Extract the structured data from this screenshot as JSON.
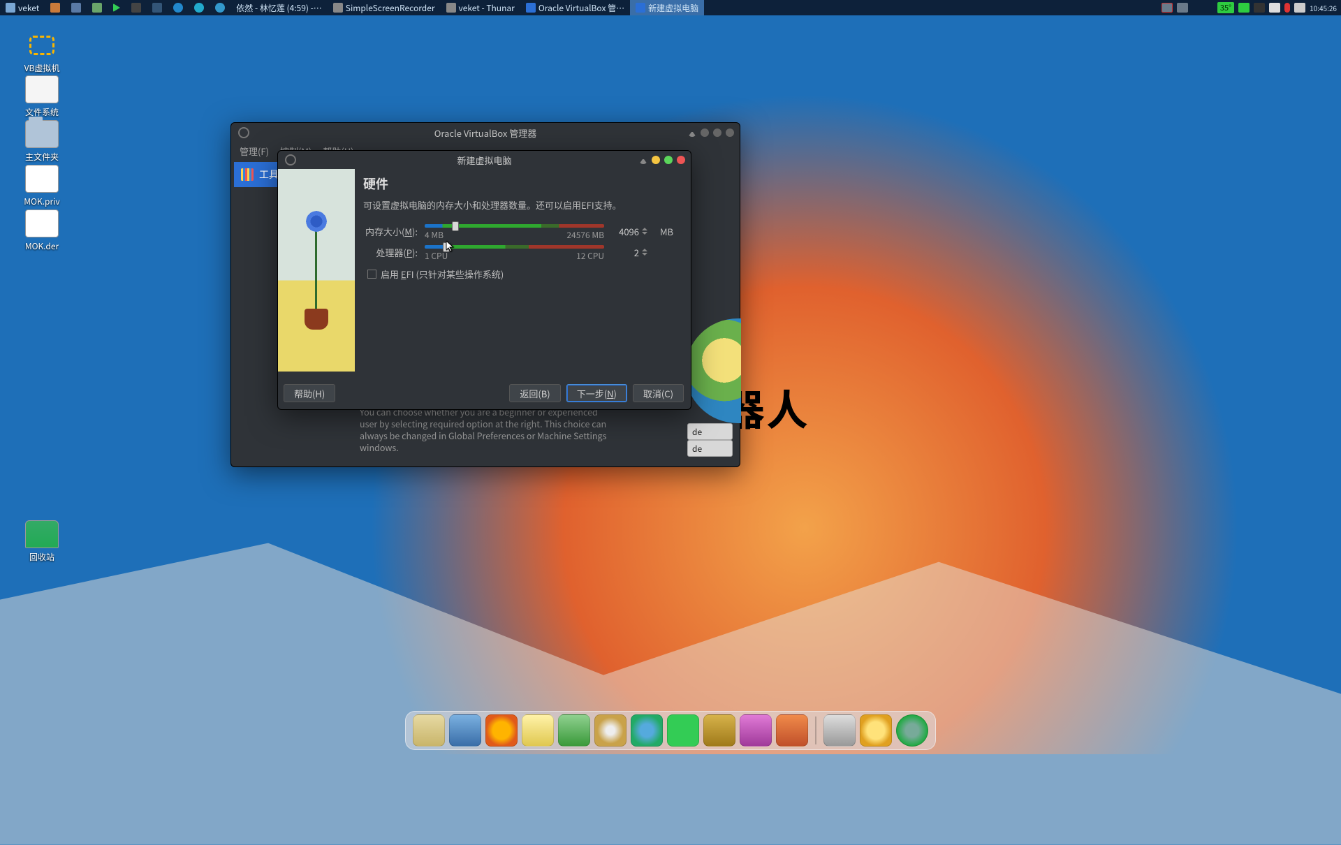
{
  "panel": {
    "menu": "veket",
    "tasks": [
      {
        "label": "依然 - 林忆莲 (4:59) -…"
      },
      {
        "label": "SimpleScreenRecorder"
      },
      {
        "label": "veket - Thunar"
      },
      {
        "label": "Oracle VirtualBox 管…",
        "active": false
      },
      {
        "label": "新建虚拟电脑",
        "active": true
      }
    ],
    "temp": "35°",
    "clock": "10:45:26"
  },
  "desktop_icons": [
    {
      "id": "di-vb",
      "label": "VB虚拟机"
    },
    {
      "id": "di-fs",
      "label": "文件系统"
    },
    {
      "id": "di-home",
      "label": "主文件夹"
    },
    {
      "id": "di-mokp",
      "label": "MOK.priv"
    },
    {
      "id": "di-mokd",
      "label": "MOK.der"
    },
    {
      "id": "di-trash",
      "label": "回收站"
    }
  ],
  "decor_text": "器人",
  "vbox_mgr": {
    "title": "Oracle VirtualBox 管理器",
    "menu": {
      "manage": "管理(F)",
      "control": "控制(M)",
      "help": "帮助(H)"
    },
    "tools_label": "工具",
    "mode_btn_suffix": "de",
    "desc": "You can choose whether you are a beginner or experienced user by selecting required option at the right. This choice can always be changed in Global Preferences or Machine Settings windows."
  },
  "wizard": {
    "title": "新建虚拟电脑",
    "heading": "硬件",
    "desc": "可设置虚拟电脑的内存大小和处理器数量。还可以启用EFI支持。",
    "memory": {
      "label_pre": "内存大小(",
      "label_u": "M",
      "label_post": "):",
      "min": "4 MB",
      "max": "24576 MB",
      "value": "4096",
      "unit": "MB",
      "thumb_pct": 15
    },
    "cpu": {
      "label_pre": "处理器(",
      "label_u": "P",
      "label_post": "):",
      "min": "1 CPU",
      "max": "12 CPU",
      "value": "2",
      "thumb_pct": 10
    },
    "efi": {
      "label_pre": "启用 ",
      "label_u": "E",
      "label_post": "FI (只针对某些操作系统)"
    },
    "buttons": {
      "help": "帮助(H)",
      "back": "返回(B)",
      "next_pre": "下一步(",
      "next_u": "N",
      "next_post": ")",
      "cancel": "取消(C)"
    }
  },
  "dock_count": 14
}
